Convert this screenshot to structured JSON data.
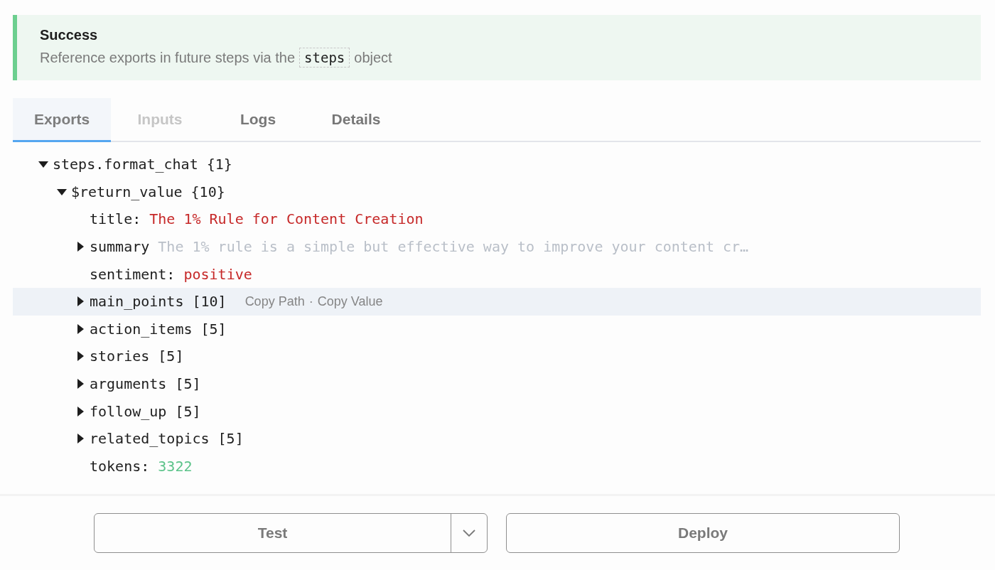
{
  "banner": {
    "title": "Success",
    "message_before": "Reference exports in future steps via the",
    "code": "steps",
    "message_after": "object"
  },
  "tabs": [
    {
      "label": "Exports",
      "selected": true,
      "disabled": false
    },
    {
      "label": "Inputs",
      "selected": false,
      "disabled": true
    },
    {
      "label": "Logs",
      "selected": false,
      "disabled": false
    },
    {
      "label": "Details",
      "selected": false,
      "disabled": false
    }
  ],
  "tree": [
    {
      "kind": "node",
      "label": "steps.format_chat",
      "count": "{1}",
      "expanded": true,
      "highlighted": false,
      "children": [
        {
          "kind": "node",
          "label": "$return_value",
          "count": "{10}",
          "expanded": true,
          "highlighted": false,
          "children": [
            {
              "kind": "string_field",
              "key": "title:",
              "value": "The 1% Rule for Content Creation"
            },
            {
              "kind": "node",
              "label": "summary",
              "preview": "The 1% rule is a simple but effective way to improve your content cr…",
              "expanded": false,
              "highlighted": false
            },
            {
              "kind": "string_field",
              "key": "sentiment:",
              "value": "positive"
            },
            {
              "kind": "node",
              "label": "main_points",
              "count": "[10]",
              "expanded": false,
              "highlighted": true,
              "actions": [
                "Copy Path",
                "Copy Value"
              ],
              "action_separator": "·"
            },
            {
              "kind": "node",
              "label": "action_items",
              "count": "[5]",
              "expanded": false,
              "highlighted": false
            },
            {
              "kind": "node",
              "label": "stories",
              "count": "[5]",
              "expanded": false,
              "highlighted": false
            },
            {
              "kind": "node",
              "label": "arguments",
              "count": "[5]",
              "expanded": false,
              "highlighted": false
            },
            {
              "kind": "node",
              "label": "follow_up",
              "count": "[5]",
              "expanded": false,
              "highlighted": false
            },
            {
              "kind": "node",
              "label": "related_topics",
              "count": "[5]",
              "expanded": false,
              "highlighted": false
            },
            {
              "kind": "number_field",
              "key": "tokens:",
              "value": "3322"
            }
          ]
        }
      ]
    }
  ],
  "footer": {
    "test_button": "Test",
    "deploy_button": "Deploy"
  }
}
